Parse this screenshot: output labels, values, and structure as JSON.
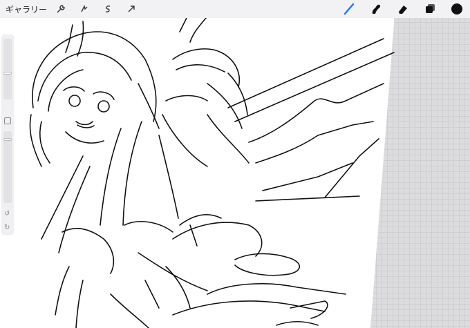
{
  "toolbar": {
    "gallery_label": "ギャラリー",
    "left_tools": [
      {
        "icon": "wrench-icon"
      },
      {
        "icon": "adjustments-icon"
      },
      {
        "icon": "selection-icon"
      },
      {
        "icon": "transform-arrow-icon"
      }
    ],
    "right_tools": [
      {
        "icon": "brush-icon",
        "active": true
      },
      {
        "icon": "smudge-icon"
      },
      {
        "icon": "eraser-icon"
      },
      {
        "icon": "layers-icon"
      }
    ],
    "current_color": "#111111"
  },
  "sidebar": {
    "undo_symbol": "↺",
    "redo_symbol": "↻"
  },
  "colors": {
    "brush_active": "#2b6fe6",
    "canvas_bg": "#ffffff",
    "outside_canvas": "#dcdcde"
  }
}
